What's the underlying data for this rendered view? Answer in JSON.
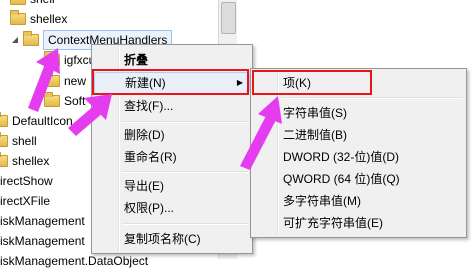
{
  "tree": {
    "items": [
      {
        "label": "shell"
      },
      {
        "label": "shellex"
      },
      {
        "label": "ContextMenuHandlers"
      },
      {
        "label": "igfxcu"
      },
      {
        "label": "new"
      },
      {
        "label": "Soft"
      },
      {
        "label": "DefaultIcon"
      },
      {
        "label": "shell"
      },
      {
        "label": "shellex"
      },
      {
        "label": "irectShow"
      },
      {
        "label": "irectXFile"
      },
      {
        "label": "iskManagement"
      },
      {
        "label": "iskManagement"
      },
      {
        "label": "iskManagement.DataObject"
      }
    ]
  },
  "context_menu": {
    "items": {
      "collapse": "折叠",
      "new": "新建(N)",
      "find": "查找(F)...",
      "delete": "删除(D)",
      "rename": "重命名(R)",
      "export": "导出(E)",
      "permissions": "权限(P)...",
      "copy_key_name": "复制项名称(C)"
    }
  },
  "submenu": {
    "items": {
      "key": "项(K)",
      "string_value": "字符串值(S)",
      "binary_value": "二进制值(B)",
      "dword_value": "DWORD (32-位)值(D)",
      "qword_value": "QWORD (64 位)值(Q)",
      "multi_string_value": "多字符串值(M)",
      "expandable_string_value": "可扩充字符串值(E)"
    }
  },
  "colors": {
    "highlight_box": "#e8151b",
    "arrow": "#e63cf0"
  }
}
